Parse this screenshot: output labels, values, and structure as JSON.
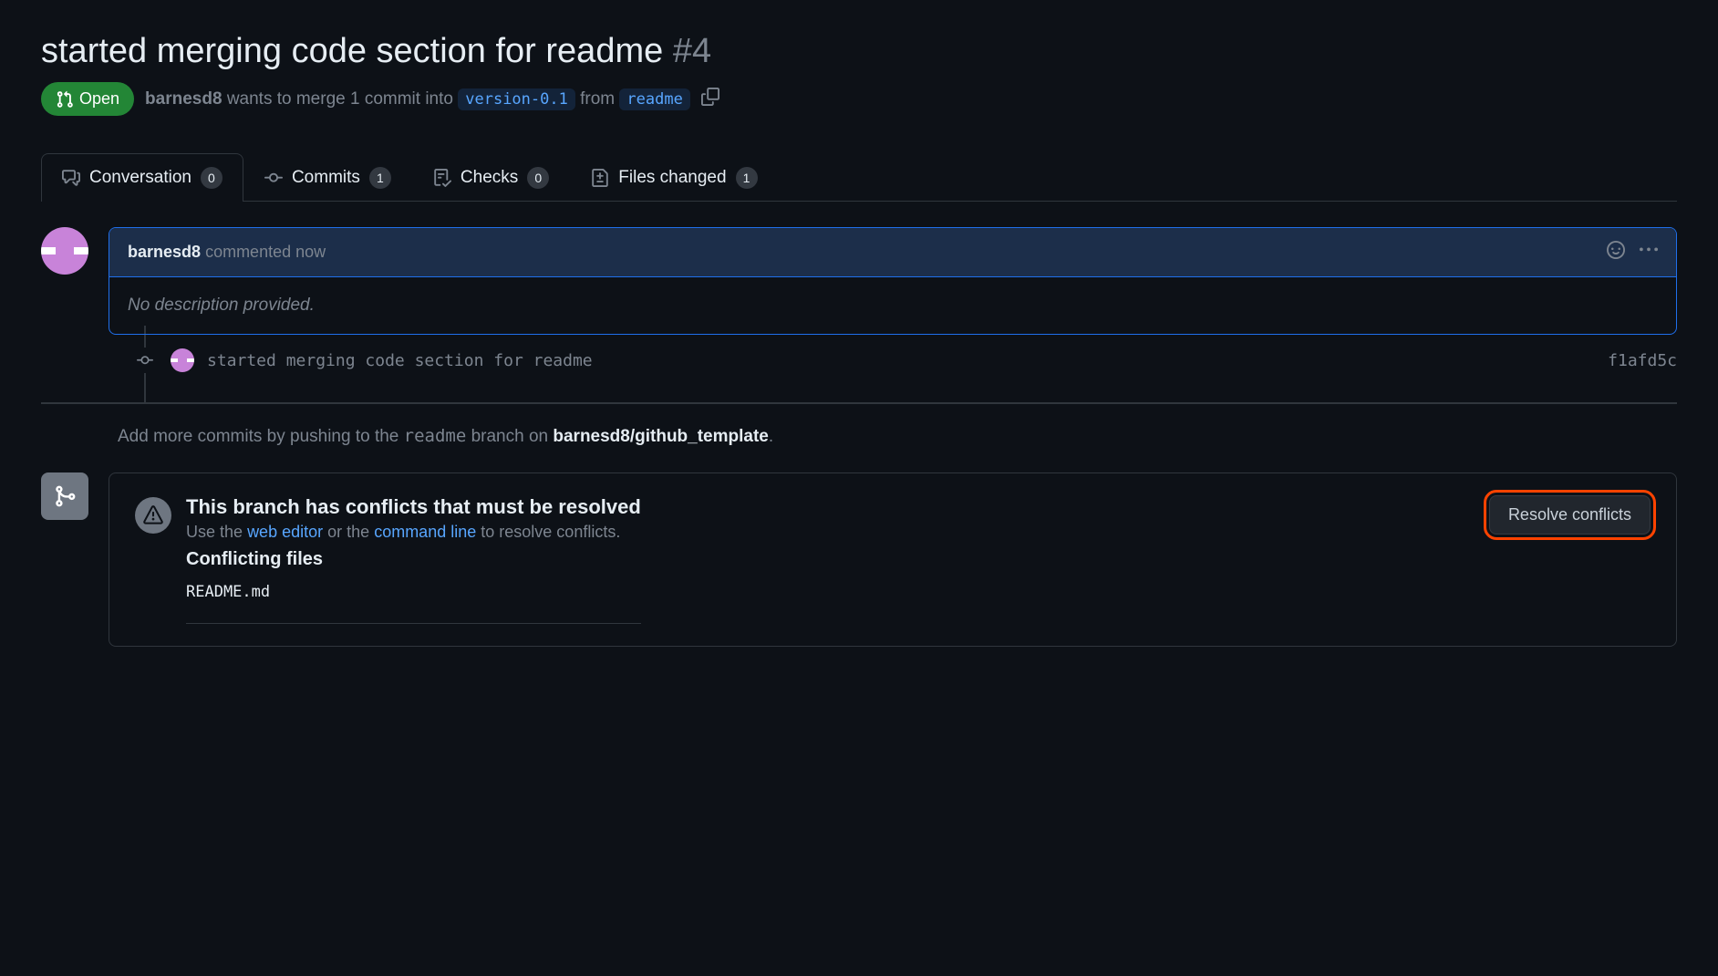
{
  "pr": {
    "title": "started merging code section for readme",
    "number": "#4",
    "state": "Open",
    "author": "barnesd8",
    "merge_text_1": "wants to merge 1 commit into",
    "base_branch": "version-0.1",
    "merge_text_2": "from",
    "head_branch": "readme"
  },
  "tabs": {
    "conversation": {
      "label": "Conversation",
      "count": "0"
    },
    "commits": {
      "label": "Commits",
      "count": "1"
    },
    "checks": {
      "label": "Checks",
      "count": "0"
    },
    "files": {
      "label": "Files changed",
      "count": "1"
    }
  },
  "comment": {
    "author": "barnesd8",
    "action": "commented now",
    "body": "No description provided."
  },
  "commit": {
    "message": "started merging code section for readme",
    "sha": "f1afd5c"
  },
  "push_hint": {
    "prefix": "Add more commits by pushing to the",
    "branch": "readme",
    "mid": "branch on",
    "repo": "barnesd8/github_template",
    "suffix": "."
  },
  "conflict": {
    "title": "This branch has conflicts that must be resolved",
    "sub_prefix": "Use the",
    "web_editor": "web editor",
    "sub_mid": "or the",
    "command_line": "command line",
    "sub_suffix": "to resolve conflicts.",
    "files_title": "Conflicting files",
    "file": "README.md",
    "resolve_btn": "Resolve conflicts"
  }
}
